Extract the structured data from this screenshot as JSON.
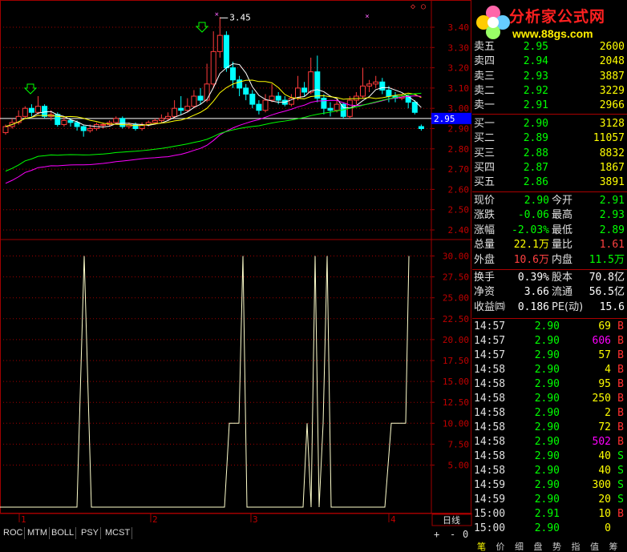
{
  "chart_area": {
    "price_axis": [
      "3.40",
      "3.30",
      "3.20",
      "3.10",
      "3.00",
      "2.90",
      "2.80",
      "2.70",
      "2.60",
      "2.50",
      "2.40"
    ],
    "current_price_tag": "2.95",
    "high_annotation": "3.45",
    "indicator_axis": [
      "30.00",
      "27.50",
      "25.00",
      "22.50",
      "20.00",
      "17.50",
      "15.00",
      "12.50",
      "10.00",
      "7.50",
      "5.00"
    ],
    "date_markers": [
      "1",
      "2",
      "3",
      "4"
    ],
    "period_label": "日线",
    "zoom_controls": {
      "plus": "+",
      "minus": "-",
      "zero": "0"
    },
    "indicator_tabs": [
      "ROC",
      "MTM",
      "BOLL",
      "PSY",
      "MCST"
    ],
    "colors": {
      "up": "#ff3b3b",
      "down": "#00ffff",
      "ma5": "#ffffff",
      "ma10": "#ffff00",
      "ma20": "#ff00ff",
      "ma60": "#00ff00",
      "grid": "#a00000",
      "indicator": "#ffffcc"
    }
  },
  "logo": {
    "title": "分析家公式网",
    "url": "www.88gs.com"
  },
  "order_book": {
    "sell": [
      {
        "label": "卖五",
        "price": "2.95",
        "volume": "2600"
      },
      {
        "label": "卖四",
        "price": "2.94",
        "volume": "2048"
      },
      {
        "label": "卖三",
        "price": "2.93",
        "volume": "3887"
      },
      {
        "label": "卖二",
        "price": "2.92",
        "volume": "3229"
      },
      {
        "label": "卖一",
        "price": "2.91",
        "volume": "2966"
      }
    ],
    "buy": [
      {
        "label": "买一",
        "price": "2.90",
        "volume": "3128"
      },
      {
        "label": "买二",
        "price": "2.89",
        "volume": "11057"
      },
      {
        "label": "买三",
        "price": "2.88",
        "volume": "8832"
      },
      {
        "label": "买四",
        "price": "2.87",
        "volume": "1867"
      },
      {
        "label": "买五",
        "price": "2.86",
        "volume": "3891"
      }
    ]
  },
  "quote": [
    {
      "l1": "现价",
      "v1": "2.90",
      "c1": "#00ff00",
      "l2": "今开",
      "v2": "2.91",
      "c2": "#00ff00"
    },
    {
      "l1": "涨跌",
      "v1": "-0.06",
      "c1": "#00ff00",
      "l2": "最高",
      "v2": "2.93",
      "c2": "#00ff00"
    },
    {
      "l1": "涨幅",
      "v1": "-2.03%",
      "c1": "#00ff00",
      "l2": "最低",
      "v2": "2.89",
      "c2": "#00ff00"
    },
    {
      "l1": "总量",
      "v1": "22.1万",
      "c1": "#ffff00",
      "l2": "量比",
      "v2": "1.61",
      "c2": "#ff4040"
    },
    {
      "l1": "外盘",
      "v1": "10.6万",
      "c1": "#ff4040",
      "l2": "内盘",
      "v2": "11.5万",
      "c2": "#00ff00"
    },
    {
      "l1": "换手",
      "v1": "0.39%",
      "c1": "#ffffff",
      "l2": "股本",
      "v2": "70.8亿",
      "c2": "#ffffff"
    },
    {
      "l1": "净资",
      "v1": "3.66",
      "c1": "#ffffff",
      "l2": "流通",
      "v2": "56.5亿",
      "c2": "#ffffff"
    },
    {
      "l1": "收益㈣",
      "v1": "0.186",
      "c1": "#ffffff",
      "l2": "PE(动)",
      "v2": "15.6",
      "c2": "#ffffff"
    }
  ],
  "ticks": [
    {
      "time": "14:57",
      "price": "2.90",
      "vol": "69",
      "vc": "#ffff00",
      "side": "B"
    },
    {
      "time": "14:57",
      "price": "2.90",
      "vol": "606",
      "vc": "#ff00ff",
      "side": "B"
    },
    {
      "time": "14:57",
      "price": "2.90",
      "vol": "57",
      "vc": "#ffff00",
      "side": "B"
    },
    {
      "time": "14:58",
      "price": "2.90",
      "vol": "4",
      "vc": "#ffff00",
      "side": "B"
    },
    {
      "time": "14:58",
      "price": "2.90",
      "vol": "95",
      "vc": "#ffff00",
      "side": "B"
    },
    {
      "time": "14:58",
      "price": "2.90",
      "vol": "250",
      "vc": "#ffff00",
      "side": "B"
    },
    {
      "time": "14:58",
      "price": "2.90",
      "vol": "2",
      "vc": "#ffff00",
      "side": "B"
    },
    {
      "time": "14:58",
      "price": "2.90",
      "vol": "72",
      "vc": "#ffff00",
      "side": "B"
    },
    {
      "time": "14:58",
      "price": "2.90",
      "vol": "502",
      "vc": "#ff00ff",
      "side": "B"
    },
    {
      "time": "14:58",
      "price": "2.90",
      "vol": "40",
      "vc": "#ffff00",
      "side": "S"
    },
    {
      "time": "14:58",
      "price": "2.90",
      "vol": "40",
      "vc": "#ffff00",
      "side": "S"
    },
    {
      "time": "14:59",
      "price": "2.90",
      "vol": "300",
      "vc": "#ffff00",
      "side": "S"
    },
    {
      "time": "14:59",
      "price": "2.90",
      "vol": "20",
      "vc": "#ffff00",
      "side": "S"
    },
    {
      "time": "15:00",
      "price": "2.91",
      "vol": "10",
      "vc": "#ffff00",
      "side": "B"
    },
    {
      "time": "15:00",
      "price": "2.90",
      "vol": "0",
      "vc": "#ffff00",
      "side": ""
    }
  ],
  "panel_tabs": [
    "笔",
    "价",
    "细",
    "盘",
    "势",
    "指",
    "值",
    "筹"
  ]
}
